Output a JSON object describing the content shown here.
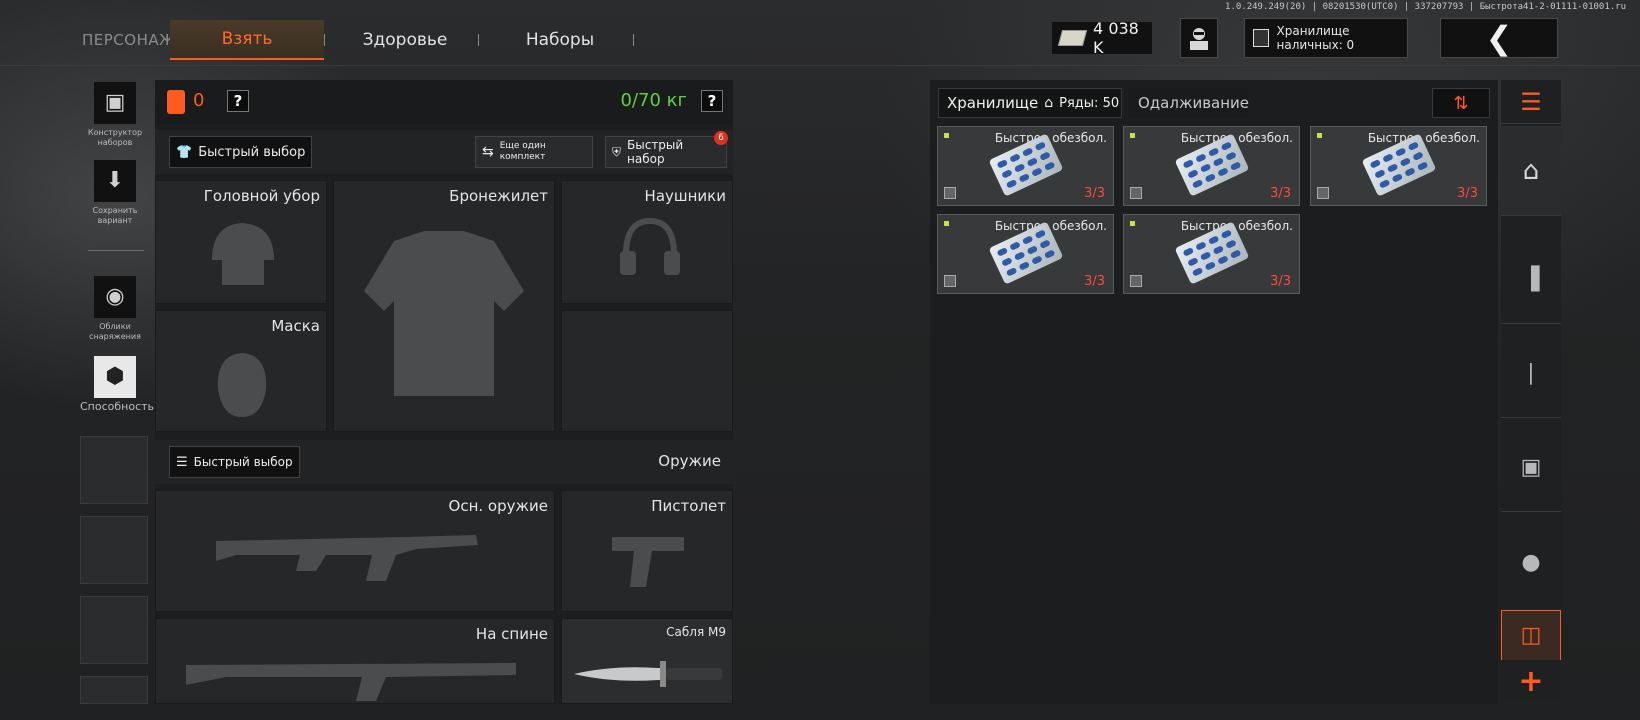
{
  "version": "1.0.249.249(20) | 08201530(UTC0) | 337207793 | Быстрота41-2-01111-01001.ru",
  "nav": {
    "section": "ПЕРСОНАЖ",
    "tabs": [
      {
        "label": "Взять",
        "active": true
      },
      {
        "label": "Здоровье",
        "active": false
      },
      {
        "label": "Наборы",
        "active": false
      }
    ]
  },
  "header": {
    "money": "4 038 K",
    "storage_cash": "Хранилище наличных: 0"
  },
  "sidebar": {
    "items": [
      {
        "label": "Конструктор наборов",
        "icon": "vest-icon"
      },
      {
        "label": "Сохранить вариант",
        "icon": "download-icon"
      },
      {
        "label": "Облики снаряжения",
        "icon": "helmet-icon"
      },
      {
        "label": "Способность",
        "icon": "ability-icon"
      }
    ]
  },
  "loadout": {
    "armor_value": "0",
    "weight": "0/70 кг",
    "quick_select": "Быстрый выбор",
    "another_set": "Еще один комплект",
    "quick_set": "Быстрый набор",
    "quick_set_badge": "6",
    "slots": {
      "headwear": "Головной убор",
      "vest": "Бронежилет",
      "headphones": "Наушники",
      "mask": "Маска"
    },
    "weapons": {
      "quick_select": "Быстрый выбор",
      "title": "Оружие",
      "primary": "Осн. оружие",
      "pistol": "Пистолет",
      "back": "На спине",
      "melee": "Сабля М9"
    }
  },
  "storage": {
    "tab_storage": "Хранилище",
    "rows_label": "Ряды: 50",
    "tab_lending": "Одалживание",
    "items": [
      {
        "name": "Быстрое обезбол.",
        "count": "3/3"
      },
      {
        "name": "Быстрое обезбол.",
        "count": "3/3"
      },
      {
        "name": "Быстрое обезбол.",
        "count": "3/3"
      },
      {
        "name": "Быстрое обезбол.",
        "count": "3/3"
      },
      {
        "name": "Быстрое обезбол.",
        "count": "3/3"
      }
    ]
  },
  "rail": {
    "add_label": "+"
  },
  "colors": {
    "accent": "#ff5a1f",
    "weight_ok": "#5fd13a",
    "count_red": "#ff4a3a"
  }
}
